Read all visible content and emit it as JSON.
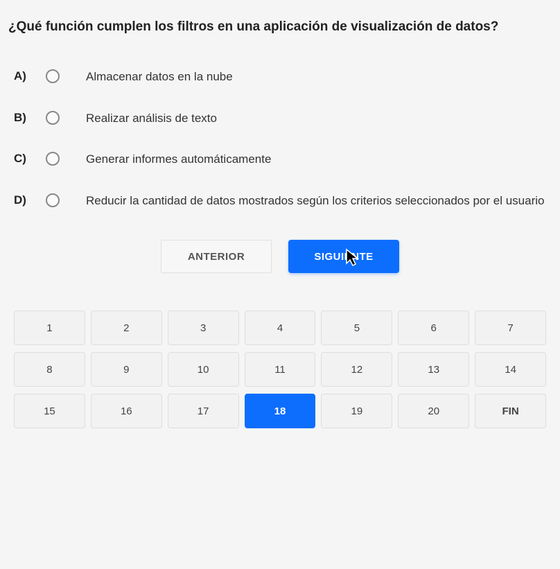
{
  "question": "¿Qué función cumplen los filtros en una aplicación de visualización de datos?",
  "options": [
    {
      "letter": "A)",
      "text": "Almacenar datos en la nube"
    },
    {
      "letter": "B)",
      "text": "Realizar análisis de texto"
    },
    {
      "letter": "C)",
      "text": "Generar informes automáticamente"
    },
    {
      "letter": "D)",
      "text": "Reducir la cantidad de datos mostrados según los criterios seleccionados por el usuario"
    }
  ],
  "nav": {
    "prev": "ANTERIOR",
    "next": "SIGUIENTE"
  },
  "pager": {
    "items": [
      "1",
      "2",
      "3",
      "4",
      "5",
      "6",
      "7",
      "8",
      "9",
      "10",
      "11",
      "12",
      "13",
      "14",
      "15",
      "16",
      "17",
      "18",
      "19",
      "20",
      "FIN"
    ],
    "active": "18"
  }
}
